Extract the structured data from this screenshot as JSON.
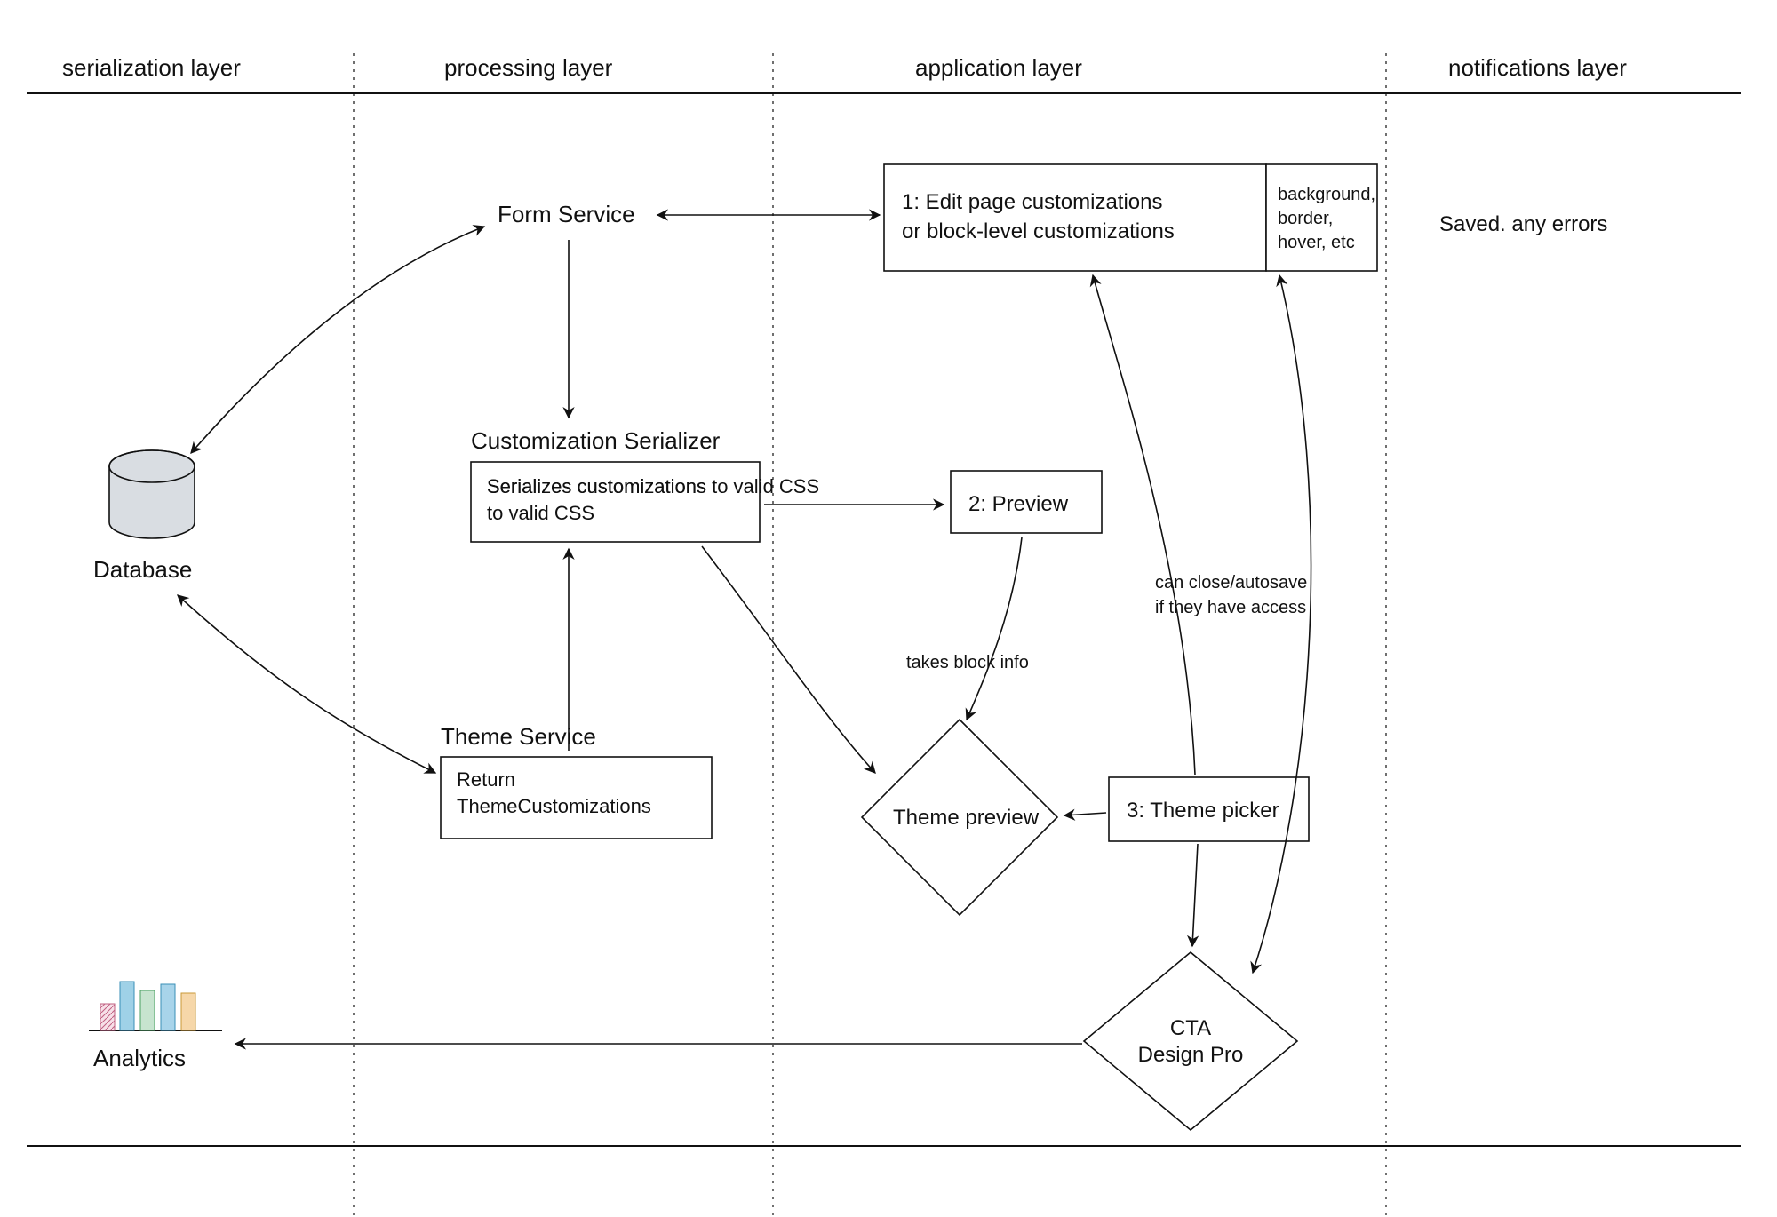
{
  "lanes": {
    "serialization": "serialization layer",
    "processing": "processing layer",
    "application": "application layer",
    "notifications": "notifications layer"
  },
  "nodes": {
    "database_label": "Database",
    "analytics_label": "Analytics",
    "form_service": "Form Service",
    "customization_serializer_title": "Customization Serializer",
    "customization_serializer_body": "Serializes customizations to valid CSS",
    "theme_service_title": "Theme Service",
    "theme_service_body1": "Return",
    "theme_service_body2": "ThemeCustomizations",
    "edit_box_line1": "1: Edit page customizations",
    "edit_box_line2": "or block-level customizations",
    "edit_box_side1": "background,",
    "edit_box_side2": "border,",
    "edit_box_side3": "hover, etc",
    "preview_label": "2: Preview",
    "theme_preview_label": "Theme preview",
    "theme_picker_label": "3: Theme picker",
    "cta_label_line1": "CTA",
    "cta_label_line2": "Design Pro",
    "notification_text": "Saved. any errors"
  },
  "annotations": {
    "takes_block_info": "takes block info",
    "can_close_line1": "can close/autosave",
    "can_close_line2": "if they have access"
  }
}
